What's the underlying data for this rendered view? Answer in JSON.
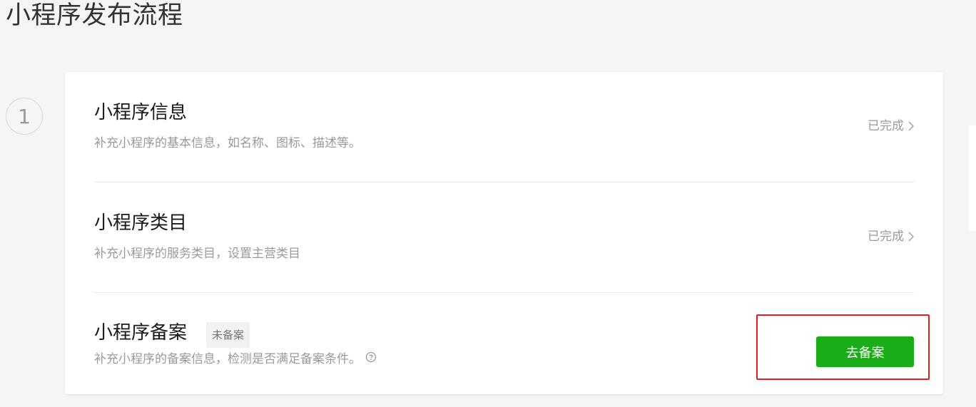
{
  "page": {
    "title": "小程序发布流程"
  },
  "step": {
    "number": "1"
  },
  "sections": [
    {
      "title": "小程序信息",
      "description": "补充小程序的基本信息，如名称、图标、描述等。",
      "status": "已完成",
      "status_icon": "chevron-right-icon"
    },
    {
      "title": "小程序类目",
      "description": "补充小程序的服务类目，设置主营类目",
      "status": "已完成",
      "status_icon": "chevron-right-icon"
    },
    {
      "title": "小程序备案",
      "badge": "未备案",
      "description": "补充小程序的备案信息，检测是否满足备案条件。",
      "help_icon": "question-circle-icon",
      "action_label": "去备案"
    }
  ],
  "colors": {
    "primary_button": "#1aad19",
    "highlight_border": "#e02020",
    "muted_text": "#9a9a9a",
    "background": "#f5f5f5"
  }
}
